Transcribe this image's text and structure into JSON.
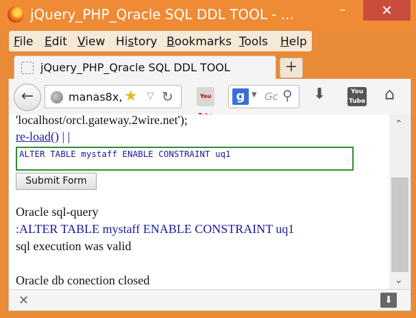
{
  "window": {
    "title": "jQuery_PHP_Qracle SQL DDL TOOL - ...",
    "minimize": "–",
    "maximize": "□",
    "close": "✕"
  },
  "menu": {
    "file_acc": "F",
    "file_rest": "ile",
    "edit_acc": "E",
    "edit_rest": "dit",
    "view_acc": "V",
    "view_rest": "iew",
    "history_pre": "Hi",
    "history_acc": "s",
    "history_rest": "tory",
    "bookmarks_acc": "B",
    "bookmarks_rest": "ookmarks",
    "tools_acc": "T",
    "tools_rest": "ools",
    "help_acc": "H",
    "help_rest": "elp"
  },
  "tab": {
    "title": "jQuery_PHP_Qracle SQL DDL TOOL",
    "new_tab": "+"
  },
  "nav": {
    "back_glyph": "←",
    "url": "manas8x,",
    "search_placeholder": "Gc",
    "youtube_label": "You Tube",
    "ext_label": "You Tube"
  },
  "icons": {
    "back": "back-arrow-icon",
    "globe": "globe-icon",
    "star": "star-icon",
    "reload": "reload-icon",
    "search": "google-search-icon",
    "download": "download-icon",
    "youtube": "youtube-icon",
    "home": "home-icon"
  },
  "content": {
    "line1": "'localhost/orcl.gateway.2wire.net');",
    "reload_link": "re-load()",
    "sep": " | |",
    "sql_value": "ALTER TABLE mystaff ENABLE CONSTRAINT uq1",
    "submit_label": "Submit Form",
    "result_heading": "Oracle sql-query",
    "result_query": ":ALTER TABLE mystaff ENABLE CONSTRAINT uq1",
    "result_status": "sql execution was valid",
    "close_msg": "Oracle db conection closed"
  },
  "colors": {
    "titlebar": "#ef8a35",
    "link": "#1a1a9a",
    "sql_border": "#2e8b2e"
  }
}
